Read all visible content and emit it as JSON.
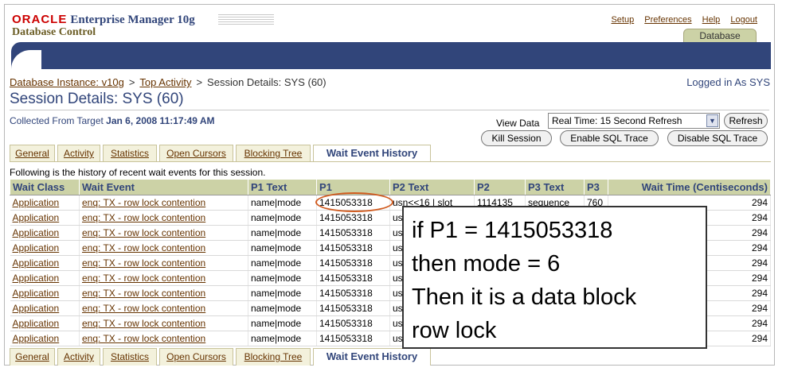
{
  "header": {
    "brand": "ORACLE",
    "product": "Enterprise Manager 10g",
    "subtitle": "Database Control",
    "global_links": [
      "Setup",
      "Preferences",
      "Help",
      "Logout"
    ],
    "active_tab": "Database"
  },
  "breadcrumb": {
    "items": [
      "Database Instance: v10g",
      "Top Activity"
    ],
    "current": "Session Details: SYS (60)",
    "separator": ">"
  },
  "logged_in": "Logged in As SYS",
  "page_title": "Session Details: SYS (60)",
  "collected": {
    "label": "Collected From Target",
    "timestamp": "Jan 6, 2008 11:17:49 AM"
  },
  "view_data": {
    "label": "View Data",
    "selected": "Real Time: 15 Second Refresh",
    "refresh_button": "Refresh"
  },
  "actions": {
    "kill": "Kill Session",
    "enable_trace": "Enable SQL Trace",
    "disable_trace": "Disable SQL Trace"
  },
  "tabs": [
    "General",
    "Activity",
    "Statistics",
    "Open Cursors",
    "Blocking Tree",
    "Wait Event History"
  ],
  "active_tab_index": 5,
  "history_note": "Following is the history of recent wait events for this session.",
  "table": {
    "columns": [
      "Wait Class",
      "Wait Event",
      "P1 Text",
      "P1",
      "P2 Text",
      "P2",
      "P3 Text",
      "P3",
      "Wait Time (Centiseconds)"
    ],
    "rows": [
      [
        "Application",
        "enq: TX - row lock contention",
        "name|mode",
        "1415053318",
        "usn<<16 | slot",
        "1114135",
        "sequence",
        "760",
        "294"
      ],
      [
        "Application",
        "enq: TX - row lock contention",
        "name|mode",
        "1415053318",
        "us",
        "",
        "",
        "",
        "294"
      ],
      [
        "Application",
        "enq: TX - row lock contention",
        "name|mode",
        "1415053318",
        "us",
        "",
        "",
        "",
        "294"
      ],
      [
        "Application",
        "enq: TX - row lock contention",
        "name|mode",
        "1415053318",
        "us",
        "",
        "",
        "",
        "294"
      ],
      [
        "Application",
        "enq: TX - row lock contention",
        "name|mode",
        "1415053318",
        "us",
        "",
        "",
        "",
        "294"
      ],
      [
        "Application",
        "enq: TX - row lock contention",
        "name|mode",
        "1415053318",
        "us",
        "",
        "",
        "",
        "294"
      ],
      [
        "Application",
        "enq: TX - row lock contention",
        "name|mode",
        "1415053318",
        "us",
        "",
        "",
        "",
        "294"
      ],
      [
        "Application",
        "enq: TX - row lock contention",
        "name|mode",
        "1415053318",
        "us",
        "",
        "",
        "",
        "294"
      ],
      [
        "Application",
        "enq: TX - row lock contention",
        "name|mode",
        "1415053318",
        "us",
        "",
        "",
        "",
        "294"
      ],
      [
        "Application",
        "enq: TX - row lock contention",
        "name|mode",
        "1415053318",
        "us",
        "",
        "",
        "",
        "294"
      ]
    ]
  },
  "annotation": [
    "if P1 = 1415053318",
    "then mode =  6",
    "Then it is a data block",
    "row lock"
  ],
  "colors": {
    "brand_red": "#cc0000",
    "navy": "#31457a",
    "link_brown": "#663300",
    "header_tan": "#ccd2a6",
    "highlight_circle": "#d05a1e"
  }
}
